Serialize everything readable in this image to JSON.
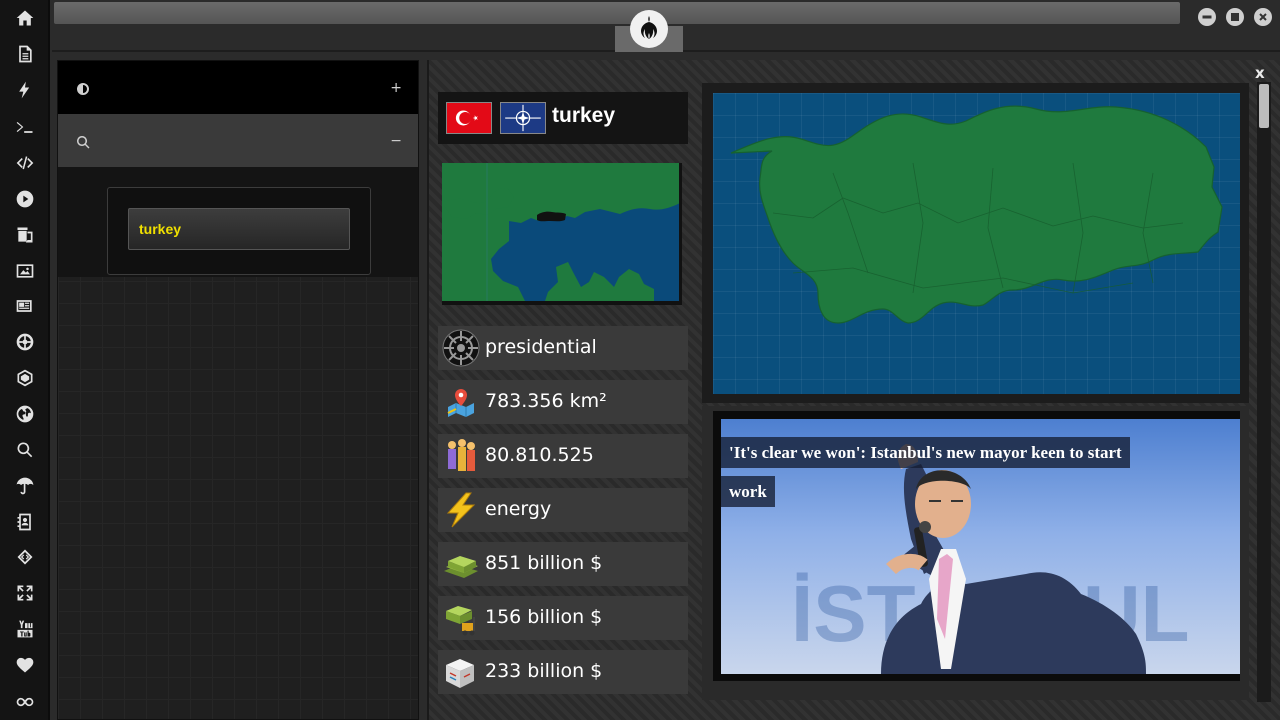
{
  "rail": {
    "icons": [
      "home-icon",
      "document-icon",
      "bolt-icon",
      "terminal-icon",
      "code-icon",
      "play-icon",
      "translate-icon",
      "image-icon",
      "newspaper-icon",
      "empire-icon",
      "network-icon",
      "globe-icon",
      "search-icon",
      "umbrella-icon",
      "contacts-icon",
      "diamond-code-icon",
      "expand-icon",
      "youtube-icon",
      "heart-icon",
      "infinity-icon"
    ]
  },
  "window": {
    "controls": [
      "minimize",
      "maximize",
      "close"
    ]
  },
  "left_panel": {
    "row1_action": "+",
    "row2_action": "−",
    "search_value": "turkey"
  },
  "country": {
    "name": "turkey",
    "stats": [
      {
        "icon": "empire-emblem-icon",
        "text": "presidential"
      },
      {
        "icon": "map-area-icon",
        "text": "783.356 km²"
      },
      {
        "icon": "population-icon",
        "text": "80.810.525"
      },
      {
        "icon": "lightning-icon",
        "text": "energy"
      },
      {
        "icon": "money-stack-icon",
        "text": "851 billion $"
      },
      {
        "icon": "money-forklift-icon",
        "text": "156 billion $"
      },
      {
        "icon": "boxes-icon",
        "text": "233 billion $"
      }
    ]
  },
  "news": {
    "headline": "'It's clear we won': Istanbul's new mayor keen to start work",
    "background_word": "İSTANBUL"
  },
  "close_label": "x",
  "colors": {
    "sea": "#0a4f7d",
    "land": "#1e7a3c",
    "turkey_highlight": "#111111",
    "search_text": "#f0e000"
  }
}
